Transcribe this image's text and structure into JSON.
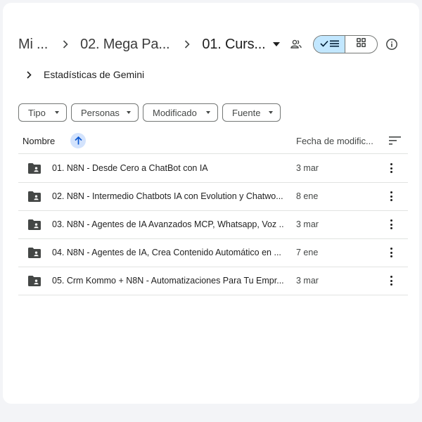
{
  "breadcrumb": {
    "items": [
      "Mi ...",
      "02. Mega Pa...",
      "01. Curs..."
    ]
  },
  "gemini": {
    "label": "Estadísticas de Gemini"
  },
  "filters": [
    "Tipo",
    "Personas",
    "Modificado",
    "Fuente"
  ],
  "table": {
    "col_name": "Nombre",
    "col_date": "Fecha de modific...",
    "rows": [
      {
        "name": "01. N8N - Desde Cero a ChatBot con IA",
        "date": "3 mar"
      },
      {
        "name": "02. N8N - Intermedio Chatbots IA con Evolution y Chatwo...",
        "date": "8 ene"
      },
      {
        "name": "03. N8N - Agentes de IA Avanzados MCP, Whatsapp, Voz ...",
        "date": "3 mar"
      },
      {
        "name": "04. N8N - Agentes de IA, Crea Contenido Automático en ...",
        "date": "7 ene"
      },
      {
        "name": "05. Crm Kommo + N8N - Automatizaciones Para Tu Empr...",
        "date": "3 mar"
      }
    ]
  },
  "icons": {
    "breadcrumb_separator": "chevron-right-icon",
    "folder": "shared-folder-icon",
    "sort_direction": "arrow-up-icon",
    "view_list": "check-list-icon",
    "view_grid": "grid-icon",
    "info": "info-icon",
    "share": "people-icon"
  },
  "colors": {
    "accent": "#c2e7ff",
    "sort_badge": "#d3e3fd",
    "sort_arrow": "#0b57d0",
    "divider": "#e1e3e1"
  }
}
